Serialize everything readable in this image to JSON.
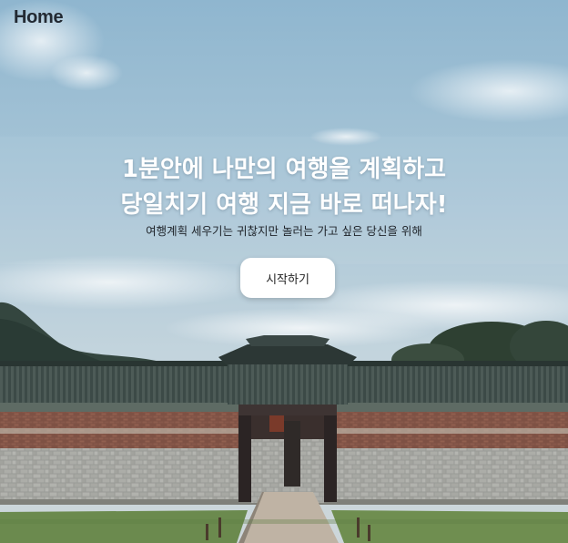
{
  "header": {
    "home_label": "Home"
  },
  "hero": {
    "headline_line1": "1분안에 나만의 여행을 계획하고",
    "headline_line2": "당일치기 여행 지금 바로 떠나자!",
    "subtitle": "여행계획 세우기는 귀찮지만 놀러는 가고 싶은 당신을 위해",
    "cta_label": "시작하기"
  }
}
